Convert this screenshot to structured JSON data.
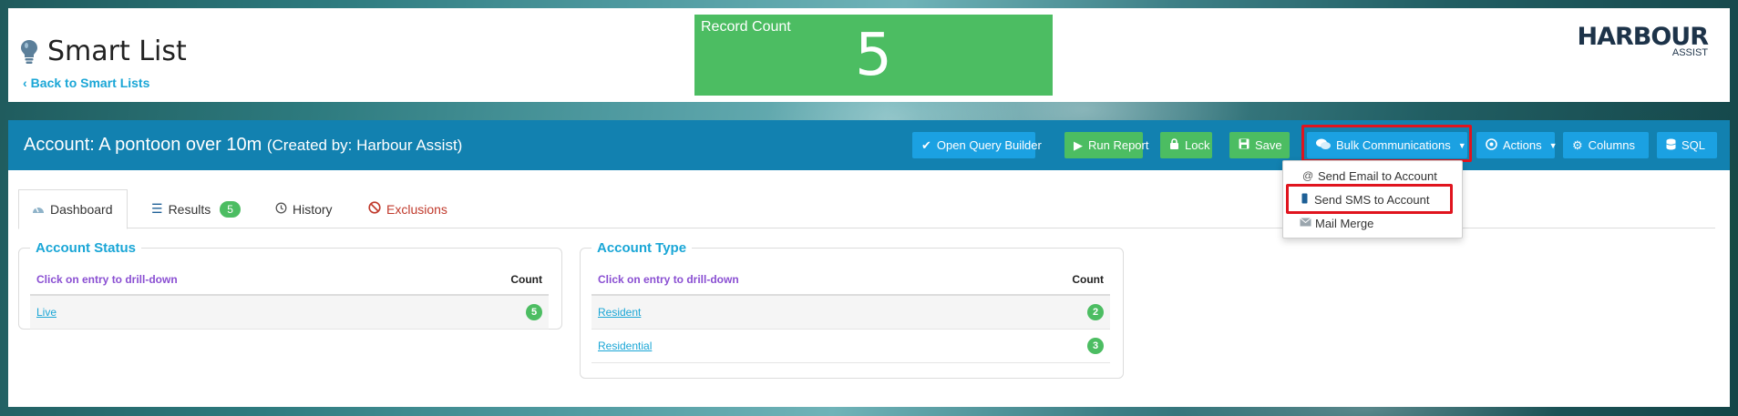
{
  "header": {
    "title": "Smart List",
    "back_link": "Back to Smart Lists",
    "record_count_label": "Record Count",
    "record_count_value": "5",
    "logo_brand": "HARBOUR",
    "logo_sub": "ASSIST"
  },
  "panel": {
    "title": "Account: A pontoon over 10m",
    "created_by": "(Created by: Harbour Assist)"
  },
  "toolbar": {
    "open_query_builder": "Open Query Builder",
    "run_report": "Run Report",
    "lock": "Lock",
    "save": "Save",
    "bulk_communications": "Bulk Communications",
    "actions": "Actions",
    "columns": "Columns",
    "sql": "SQL"
  },
  "bulk_menu": {
    "items": [
      {
        "label": "Send Email to Account",
        "icon": "at-icon"
      },
      {
        "label": "Send SMS to Account",
        "icon": "mobile-phone-icon"
      },
      {
        "label": "Mail Merge",
        "icon": "envelope-icon"
      }
    ]
  },
  "tabs": [
    {
      "label": "Dashboard",
      "icon": "dashboard-gauge-icon",
      "active": true
    },
    {
      "label": "Results",
      "icon": "list-icon",
      "badge": "5"
    },
    {
      "label": "History",
      "icon": "history-clock-icon"
    },
    {
      "label": "Exclusions",
      "icon": "ban-icon"
    }
  ],
  "cards": {
    "account_status": {
      "title": "Account Status",
      "hint": "Click on entry to drill-down",
      "count_header": "Count",
      "rows": [
        {
          "label": "Live",
          "count": "5"
        }
      ]
    },
    "account_type": {
      "title": "Account Type",
      "hint": "Click on entry to drill-down",
      "count_header": "Count",
      "rows": [
        {
          "label": "Resident",
          "count": "2"
        },
        {
          "label": "Residential",
          "count": "3"
        }
      ]
    }
  },
  "colors": {
    "header_blue": "#1281b0",
    "button_blue": "#1ba1e2",
    "button_green": "#4cbd62",
    "link_blue": "#1aa6d6",
    "highlight_red": "#e0141e"
  }
}
